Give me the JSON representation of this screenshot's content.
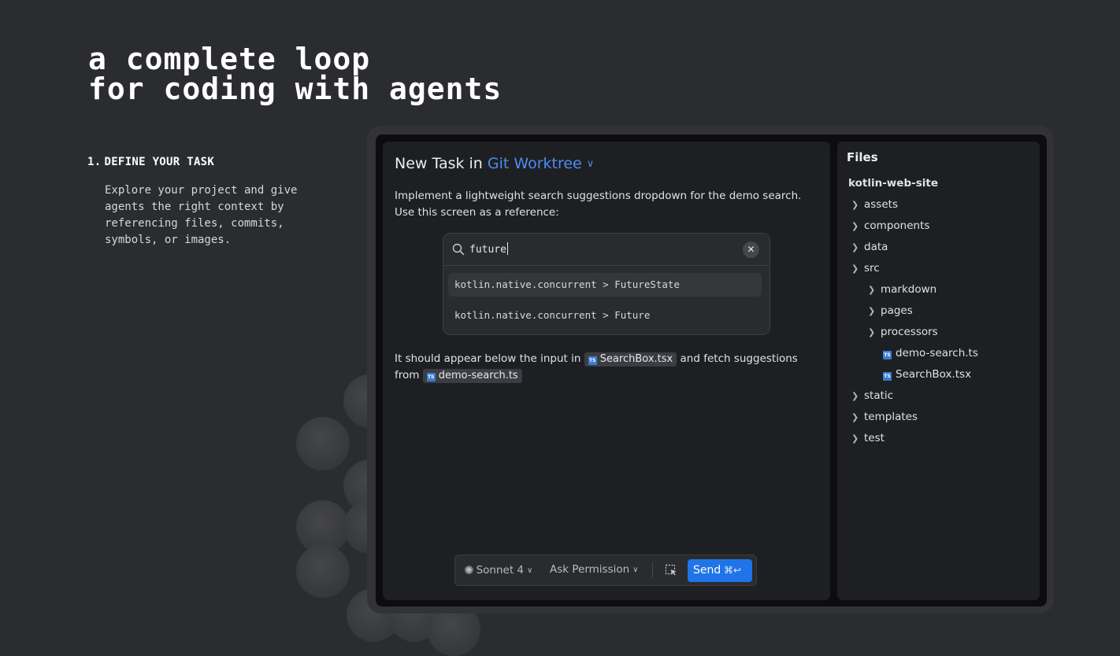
{
  "headline": {
    "line1": "a complete loop",
    "line2": "for coding with agents"
  },
  "step": {
    "number": "1.",
    "title": "DEFINE YOUR TASK",
    "description": "Explore your project and give agents the right context by referencing files, commits, symbols, or images."
  },
  "task": {
    "title_prefix": "New Task in",
    "title_link": "Git Worktree",
    "description": "Implement a lightweight search suggestions dropdown for the demo search. Use this screen as a reference:",
    "search": {
      "query": "future",
      "suggestions": [
        "kotlin.native.concurrent > FutureState",
        "kotlin.native.concurrent > Future"
      ]
    },
    "followup": {
      "before": "It should appear below the input in",
      "file1": "SearchBox.tsx",
      "middle": "and fetch suggestions from",
      "file2": "demo-search.ts",
      "ts_badge": "TS"
    }
  },
  "composer": {
    "model": "Sonnet 4",
    "permission": "Ask Permission",
    "send_label": "Send",
    "send_shortcut": "⌘↩"
  },
  "files": {
    "title": "Files",
    "root": "kotlin-web-site",
    "items": [
      {
        "label": "assets"
      },
      {
        "label": "components"
      },
      {
        "label": "data"
      },
      {
        "label": "src"
      },
      {
        "label": "markdown"
      },
      {
        "label": "pages"
      },
      {
        "label": "processors"
      },
      {
        "label": "demo-search.ts"
      },
      {
        "label": "SearchBox.tsx"
      },
      {
        "label": "static"
      },
      {
        "label": "templates"
      },
      {
        "label": "test"
      }
    ]
  },
  "colors": {
    "background": "#2b2c2f",
    "panel": "#1e1f22",
    "accent": "#4c8df6",
    "send": "#1f74e8",
    "ts_badge": "#3a7bd5"
  }
}
